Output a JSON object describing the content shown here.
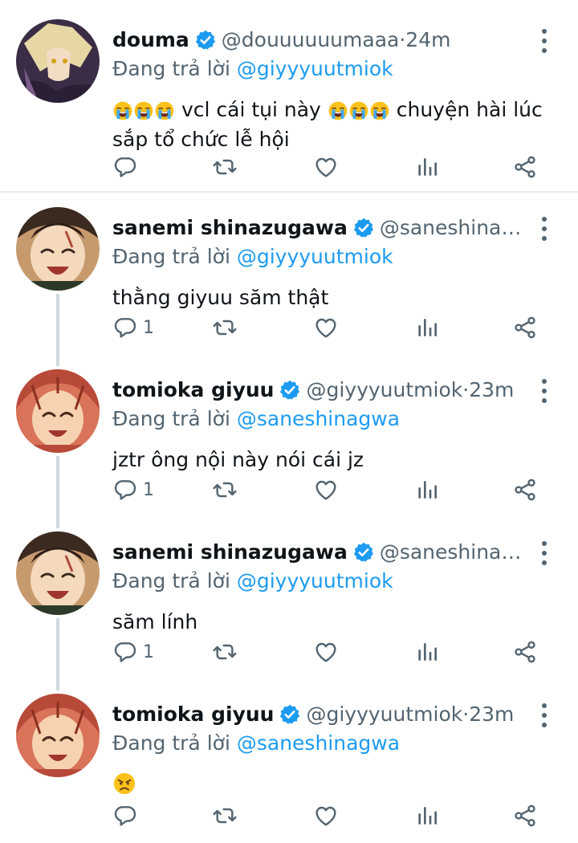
{
  "tweets": [
    {
      "name": "douma",
      "handle": "@douuuuuumaaa",
      "sep": " · ",
      "time": "24m",
      "reply_prefix": "Đang trả lời ",
      "reply_to": "@giyyyuutmiok",
      "text_before": "",
      "text_middle": "vcl cái tụi này",
      "text_after": "chuyện hài lúc sắp tổ chức lễ hội",
      "reply_count": ""
    },
    {
      "name": "sanemi shinazugawa",
      "handle": "@saneshinagw...",
      "sep": "",
      "time": "",
      "reply_prefix": "Đang trả lời ",
      "reply_to": "@giyyyuutmiok",
      "text": "thằng giyuu săm thật",
      "reply_count": "1"
    },
    {
      "name": "tomioka giyuu",
      "handle": "@giyyyuutmiok",
      "sep": " · ",
      "time": "23m",
      "reply_prefix": "Đang trả lời ",
      "reply_to": "@saneshinagwa",
      "text": "jztr ông nội này nói cái jz",
      "reply_count": "1"
    },
    {
      "name": "sanemi shinazugawa",
      "handle": "@saneshinagw...",
      "sep": "",
      "time": "",
      "reply_prefix": "Đang trả lời ",
      "reply_to": "@giyyyuutmiok",
      "text": "săm lính",
      "reply_count": "1"
    },
    {
      "name": "tomioka giyuu",
      "handle": "@giyyyuutmiok",
      "sep": " · ",
      "time": "23m",
      "reply_prefix": "Đang trả lời ",
      "reply_to": "@saneshinagwa",
      "text": "",
      "reply_count": ""
    }
  ],
  "icons": {
    "reply": "reply-icon",
    "retweet": "retweet-icon",
    "like": "heart-icon",
    "stats": "stats-icon",
    "share": "share-icon",
    "more": "more-icon",
    "verified": "verified-badge-icon",
    "crying_emoji": "loudly-crying-face-emoji",
    "angry_emoji": "angry-face-emoji"
  },
  "colors": {
    "accent": "#1d9bf0",
    "muted": "#536471",
    "text": "#0f1419",
    "thread_line": "#cfd9de"
  }
}
